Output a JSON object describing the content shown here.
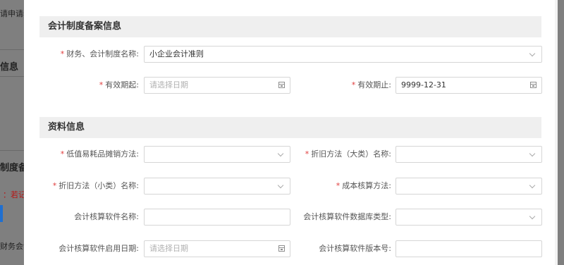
{
  "background": {
    "t1": "请申请表",
    "t2": "信息",
    "t3": "制度备",
    "t4": "：若记",
    "t5": "财务会计"
  },
  "modal": {
    "sections": {
      "accounting": "会计制度备案信息",
      "materials": "资料信息"
    },
    "fields": {
      "system_name": {
        "label": "财务、会计制度名称:",
        "value": "小企业会计准则"
      },
      "valid_from": {
        "label": "有效期起:",
        "placeholder": "请选择日期"
      },
      "valid_to": {
        "label": "有效期止:",
        "value": "9999-12-31"
      },
      "low_value_method": {
        "label": "低值易耗品摊销方法:"
      },
      "dep_major": {
        "label": "折旧方法（大类）名称:"
      },
      "dep_minor": {
        "label": "折旧方法（小类）名称:"
      },
      "cost_method": {
        "label": "成本核算方法:"
      },
      "software_name": {
        "label": "会计核算软件名称:"
      },
      "software_db": {
        "label": "会计核算软件数据库类型:"
      },
      "software_date": {
        "label": "会计核算软件启用日期:",
        "placeholder": "请选择日期"
      },
      "software_version": {
        "label": "会计核算软件版本号:"
      }
    },
    "required_mark": "*"
  }
}
